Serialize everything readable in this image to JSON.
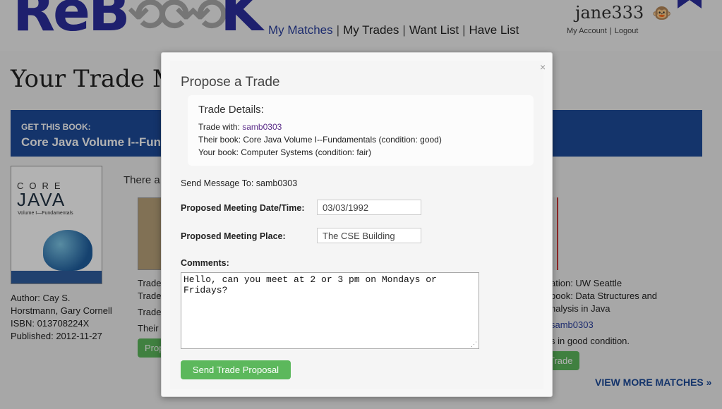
{
  "header": {
    "logo_main": "ReB",
    "logo_tail": "K",
    "nav": [
      "My Matches",
      "My Trades",
      "Want List",
      "Have List"
    ],
    "username": "jane333",
    "my_account": "My Account",
    "logout": "Logout"
  },
  "page": {
    "title": "Your Trade M",
    "banner_kicker": "GET THIS BOOK:",
    "banner_title": "Core Java Volume I--Funda",
    "cover": {
      "brand": "CORE",
      "title": "JAVA",
      "subtitle": "Volume I—Fundamentals"
    },
    "meta": {
      "author": "Author: Cay S. Horstmann, Gary Cornell",
      "isbn": "ISBN: 013708224X",
      "published": "Published: 2012-11-27"
    },
    "there_fragment": "There a",
    "left_fragments": [
      "Trade",
      "Trade",
      "Trade",
      "Their b"
    ],
    "propose_fragment": "Prop",
    "right_fragments": {
      "location": "ation: UW Seattle",
      "book_1": "book: Data Structures and",
      "book_2": "nalysis in Java",
      "user": "samb0303",
      "condition": "s in good condition."
    },
    "trade_fragment": "Trade",
    "view_more": "VIEW MORE MATCHES »"
  },
  "modal": {
    "close": "×",
    "title": "Propose a Trade",
    "details_heading": "Trade Details:",
    "trade_with_label": "Trade with: ",
    "trade_with_user": "samb0303",
    "their_book": "Their book: Core Java Volume I--Fundamentals (condition: good)",
    "your_book": "Your book: Computer Systems (condition: fair)",
    "send_to": "Send Message To: samb0303",
    "date_label": "Proposed Meeting Date/Time:",
    "date_value": "03/03/1992",
    "place_label": "Proposed Meeting Place:",
    "place_value": "The CSE Building",
    "comments_label": "Comments:",
    "comments_value": "Hello, can you meet at 2 or 3 pm on Mondays or Fridays?",
    "submit": "Send Trade Proposal"
  }
}
